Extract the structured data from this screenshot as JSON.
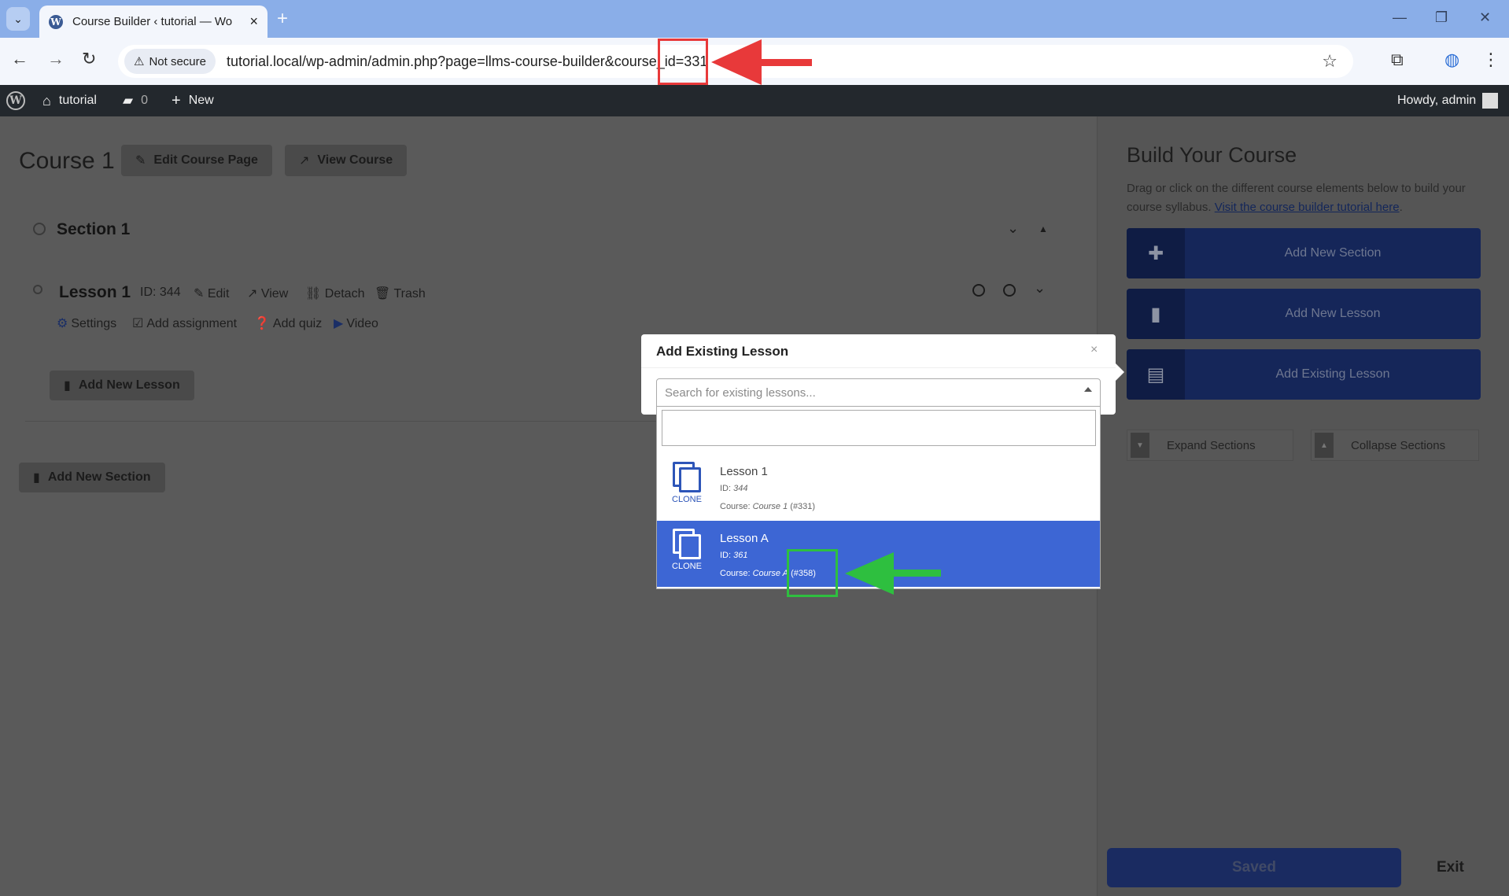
{
  "browser": {
    "tab_title": "Course Builder ‹ tutorial — Wo",
    "new_tab_glyph": "+",
    "security_label": "Not secure",
    "url": "tutorial.local/wp-admin/admin.php?page=llms-course-builder&course_id=331",
    "icons": [
      "tab-search-icon",
      "wordpress-favicon",
      "close-icon",
      "back-icon",
      "forward-icon",
      "reload-icon",
      "warning-icon",
      "star-icon",
      "extensions-icon",
      "profile-icon",
      "menu-icon",
      "minimize-icon",
      "restore-icon",
      "window-close-icon"
    ]
  },
  "adminbar": {
    "site_name": "tutorial",
    "comments_count": "0",
    "new_label": "New",
    "howdy": "Howdy, admin"
  },
  "builder": {
    "course_title": "Course 1",
    "edit_course_label": "Edit Course Page",
    "view_course_label": "View Course",
    "section_title": "Section 1",
    "lesson": {
      "title": "Lesson 1",
      "id_text": "ID: 344",
      "edit": "Edit",
      "view": "View",
      "detach": "Detach",
      "trash": "Trash",
      "settings": "Settings",
      "add_assignment": "Add assignment",
      "add_quiz": "Add quiz",
      "video": "Video"
    },
    "add_new_lesson": "Add New Lesson",
    "add_new_section": "Add New Section"
  },
  "panel": {
    "title": "Build Your Course",
    "desc": "Drag or click on the different course elements below to build your course syllabus. ",
    "desc_link": "Visit the course builder tutorial here",
    "desc_end": ".",
    "add_new_section": "Add New Section",
    "add_new_lesson": "Add New Lesson",
    "add_existing_lesson": "Add Existing Lesson",
    "expand_sections": "Expand Sections",
    "collapse_sections": "Collapse Sections",
    "saved": "Saved",
    "exit": "Exit"
  },
  "modal": {
    "title": "Add Existing Lesson",
    "close": "×",
    "search_placeholder": "Search for existing lessons...",
    "options": [
      {
        "clone_label": "CLONE",
        "name": "Lesson 1",
        "id_label": "ID: ",
        "id": "344",
        "course_label": "Course: ",
        "course": "Course 1",
        "course_id": " (#331)",
        "selected": false
      },
      {
        "clone_label": "CLONE",
        "name": "Lesson A",
        "id_label": "ID: ",
        "id": "361",
        "course_label": "Course: ",
        "course": "Course A",
        "course_id": " (#358)",
        "selected": true
      }
    ]
  },
  "colors": {
    "annotation_red": "#e8393a",
    "annotation_green": "#2ebf3f",
    "selected_option": "#3d66d4",
    "panel_button": "#152659"
  }
}
